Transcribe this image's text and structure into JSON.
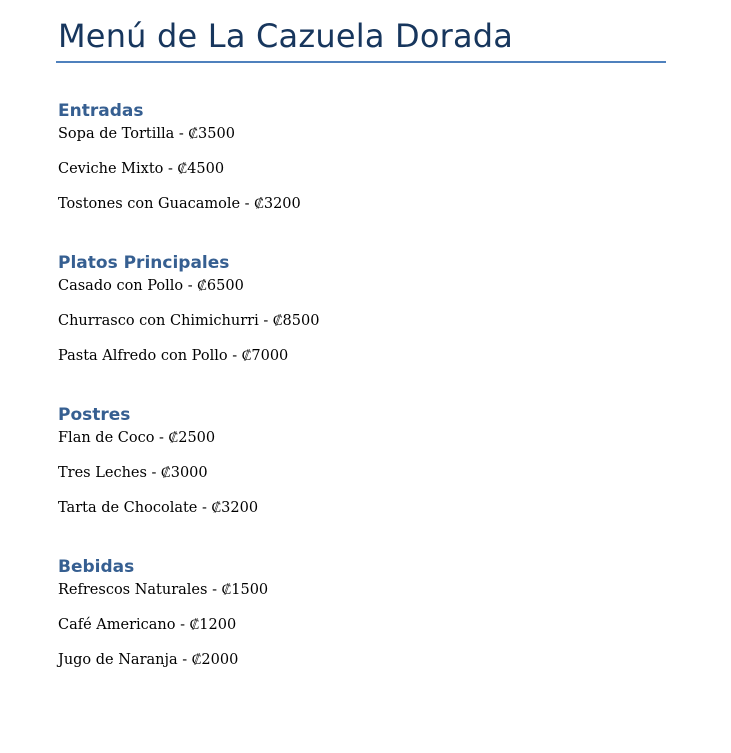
{
  "document": {
    "title": "Menú de La Cazuela Dorada",
    "accent_color": "#4f81bd",
    "title_color": "#17365d",
    "heading_color": "#365f91"
  },
  "sections": [
    {
      "heading": "Entradas",
      "items": [
        "Sopa de Tortilla - ₡3500",
        "Ceviche Mixto - ₡4500",
        "Tostones con Guacamole - ₡3200"
      ]
    },
    {
      "heading": "Platos Principales",
      "items": [
        "Casado con Pollo - ₡6500",
        "Churrasco con Chimichurri - ₡8500",
        "Pasta Alfredo con Pollo - ₡7000"
      ]
    },
    {
      "heading": "Postres",
      "items": [
        "Flan de Coco - ₡2500",
        "Tres Leches - ₡3000",
        "Tarta de Chocolate - ₡3200"
      ]
    },
    {
      "heading": "Bebidas",
      "items": [
        "Refrescos Naturales - ₡1500",
        "Café Americano - ₡1200",
        "Jugo de Naranja - ₡2000"
      ]
    }
  ]
}
